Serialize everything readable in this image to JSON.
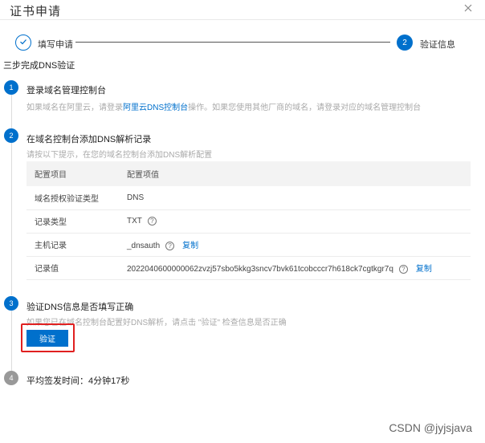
{
  "dialog": {
    "title": "证书申请",
    "close_icon": "close-icon"
  },
  "stepper": {
    "steps": [
      {
        "label": "填写申请",
        "state": "done",
        "icon": "check-icon"
      },
      {
        "number": "2",
        "label": "验证信息",
        "state": "active"
      }
    ]
  },
  "section_title": "三步完成DNS验证",
  "steps": [
    {
      "number": "1",
      "title": "登录域名管理控制台",
      "desc_prefix": "如果域名在阿里云，请登录",
      "desc_link": "阿里云DNS控制台",
      "desc_suffix": "操作。如果您使用其他厂商的域名，请登录对应的域名管理控制台"
    },
    {
      "number": "2",
      "title": "在域名控制台添加DNS解析记录",
      "desc": "请按以下提示，在您的域名控制台添加DNS解析配置"
    },
    {
      "number": "3",
      "title": "验证DNS信息是否填写正确",
      "desc": "如果您已在域名控制台配置好DNS解析，请点击 \"验证\" 检查信息是否正确",
      "button": "验证"
    },
    {
      "number": "4",
      "title": "平均签发时间：4分钟17秒"
    }
  ],
  "config_table": {
    "headers": [
      "配置项目",
      "配置项值"
    ],
    "rows": [
      {
        "item": "域名授权验证类型",
        "value": "DNS"
      },
      {
        "item": "记录类型",
        "value": "TXT",
        "help": "?"
      },
      {
        "item": "主机记录",
        "value": "_dnsauth",
        "help": "?",
        "copy": "复制"
      },
      {
        "item": "记录值",
        "value": "2022040600000062zvzj57sbo5kkg3sncv7bvk61tcobcccr7h618ck7cgtkgr7q",
        "help": "?",
        "copy": "复制"
      }
    ]
  },
  "watermark": "CSDN @jyjsjava",
  "colors": {
    "accent": "#0070cc",
    "highlight": "#e02020",
    "muted": "#999999"
  }
}
